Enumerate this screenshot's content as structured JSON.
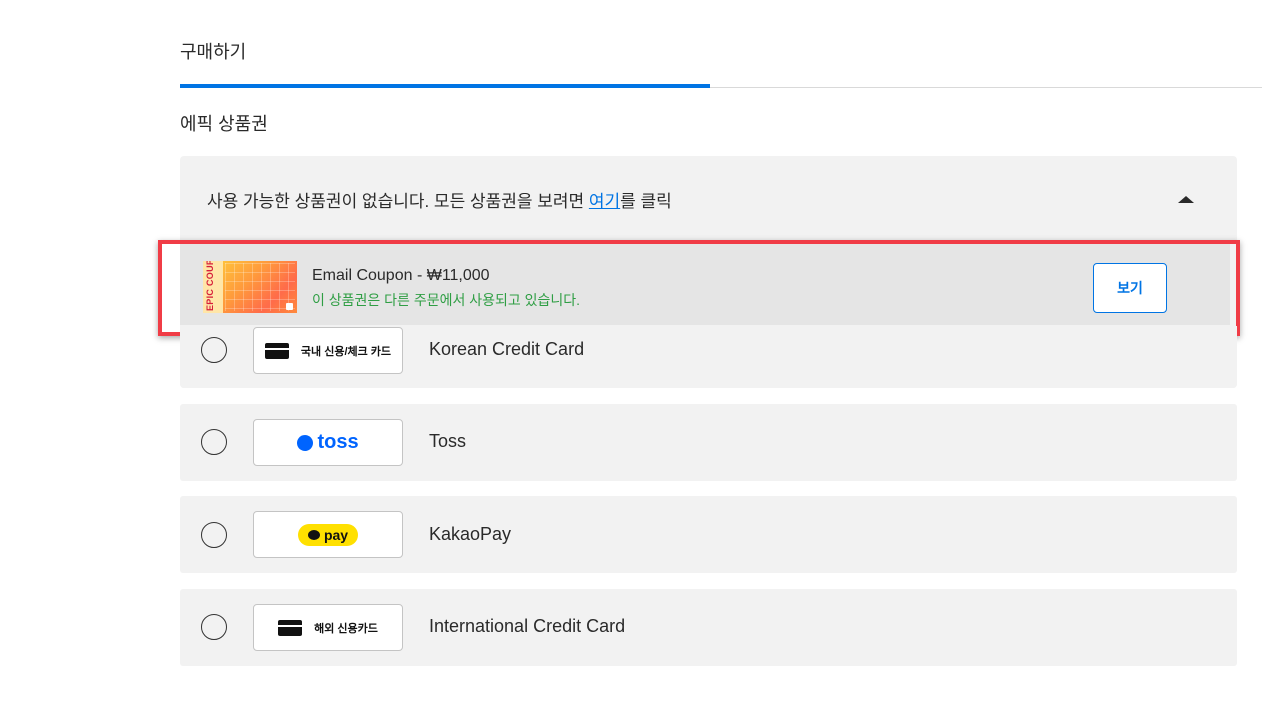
{
  "tab": {
    "title": "구매하기"
  },
  "section": {
    "title": "에픽 상품권"
  },
  "coupon_panel": {
    "message_before": "사용 가능한 상품권이 없습니다. 모든 상품권을 보려면 ",
    "link_text": "여기",
    "message_after": "를 클릭",
    "collapse_icon": "caret-up-icon"
  },
  "coupon": {
    "thumbnail_text": "EPIC COUPON",
    "name": "Email Coupon - ₩11,000",
    "status": "이 상품권은 다른 주문에서 사용되고 있습니다.",
    "view_label": "보기"
  },
  "payment_methods": [
    {
      "logo_text": "국내 신용/체크 카드",
      "icon": "credit-card-icon",
      "label": "Korean Credit Card"
    },
    {
      "logo_text": "toss",
      "icon": "toss-logo",
      "label": "Toss"
    },
    {
      "logo_text": "pay",
      "icon": "kakaopay-logo",
      "label": "KakaoPay"
    },
    {
      "logo_text": "해외 신용카드",
      "icon": "credit-card-icon",
      "label": "International Credit Card"
    }
  ],
  "colors": {
    "accent": "#0074e4",
    "status_green": "#2f9e44",
    "highlight_red": "#f03c46",
    "panel_bg": "#f2f2f2"
  }
}
